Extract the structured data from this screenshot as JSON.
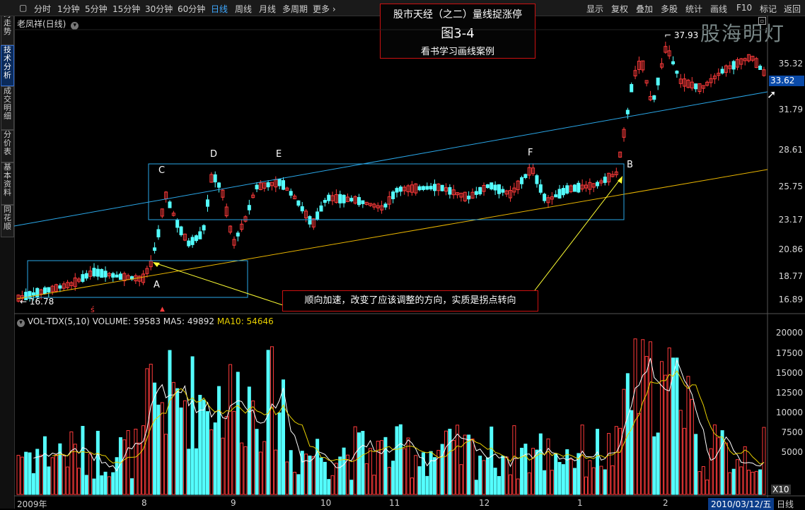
{
  "toolbar": {
    "left_items": [
      "分时",
      "1分钟",
      "5分钟",
      "15分钟",
      "30分钟",
      "60分钟",
      "日线",
      "周线",
      "月线",
      "多周期",
      "更多 ›"
    ],
    "active": "日线",
    "right_items": [
      "显示",
      "复权",
      "叠加",
      "多股",
      "统计",
      "画线",
      "F10",
      "标记",
      "返回"
    ]
  },
  "sidebar": {
    "tabs": [
      "分时走势",
      "技术分析",
      "成交明细",
      "分价表",
      "基本资料",
      "同花顺"
    ],
    "active": "技术分析"
  },
  "stock": {
    "name": "老凤祥(日线)"
  },
  "title_box": {
    "line1": "股市天经（之二）量线捉涨停",
    "line2": "图3-4",
    "line3": "看书学习画线案例"
  },
  "watermark": "股海明灯",
  "price_axis": [
    "35.32",
    "31.79",
    "28.61",
    "25.75",
    "23.17",
    "20.86",
    "18.77",
    "16.89"
  ],
  "last_price": "33.62",
  "high_label": "37.93",
  "low_label": "16.78",
  "markers": {
    "A": "A",
    "B": "B",
    "C": "C",
    "D": "D",
    "E": "E",
    "F": "F"
  },
  "annotation": "顺向加速，改变了应该调整的方向，实质是拐点转向",
  "volume": {
    "title": "VOL-TDX(5,10)",
    "volume_label": "VOLUME: 59583",
    "ma5_label": "MA5: 49892",
    "ma10_label": "MA10: 54646",
    "axis": [
      "20000",
      "17500",
      "15000",
      "12500",
      "10000",
      "7500",
      "5000"
    ],
    "unit": "X10"
  },
  "x_axis": [
    "2009年",
    "8",
    "9",
    "10",
    "11",
    "12",
    "1",
    "2"
  ],
  "current_date": "2010/03/12/五",
  "period_button": "日线",
  "colors": {
    "up": "#ff3b3b",
    "down": "#54ffff",
    "ma5": "#ffffff",
    "ma10": "#e8d000",
    "trend_blue": "#2aa7e8",
    "trend_yellow": "#e8b400"
  }
}
